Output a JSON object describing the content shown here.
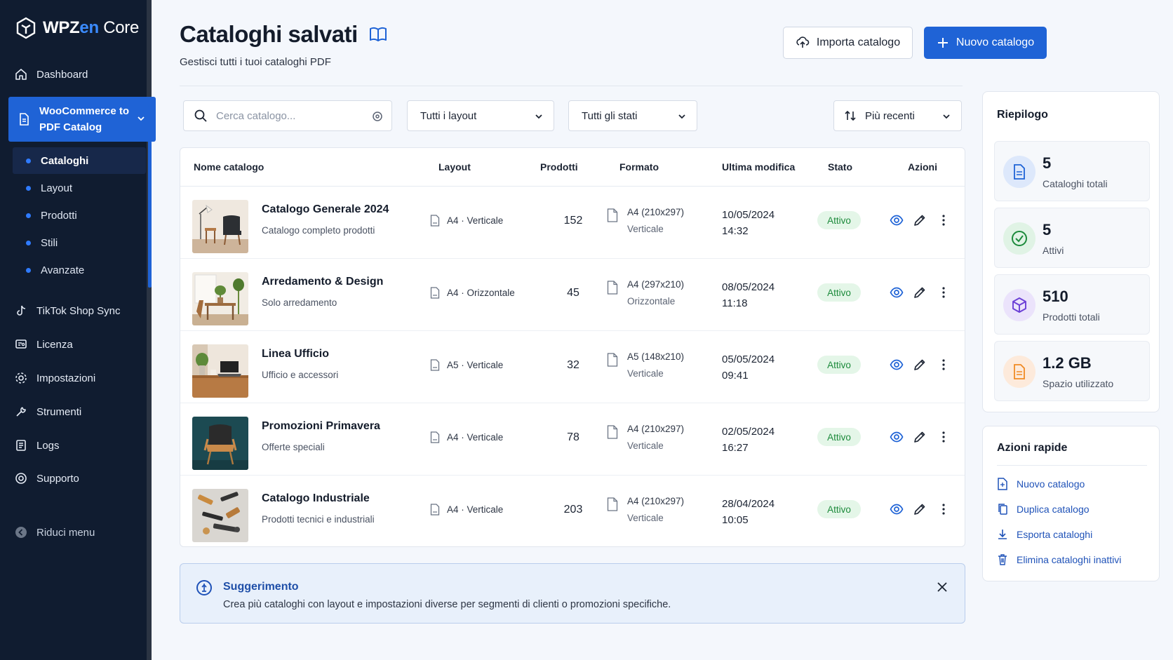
{
  "brand": {
    "part1": "WPZ",
    "part2": "en",
    "part3": " Core"
  },
  "sidebar": {
    "dashboard": "Dashboard",
    "active_section": "WooCommerce to PDF Catalog",
    "sub_items": [
      "Cataloghi",
      "Layout",
      "Prodotti",
      "Stili",
      "Avanzate"
    ],
    "items": [
      "TikTok Shop Sync",
      "Licenza",
      "Impostazioni",
      "Strumenti",
      "Logs",
      "Supporto"
    ],
    "collapse": "Riduci menu"
  },
  "header": {
    "title": "Cataloghi salvati",
    "subtitle": "Gestisci tutti i tuoi cataloghi PDF",
    "import_label": "Importa catalogo",
    "new_label": "Nuovo catalogo"
  },
  "filters": {
    "search_placeholder": "Cerca catalogo...",
    "layout": "Tutti i layout",
    "status": "Tutti gli stati",
    "sort": "Più recenti"
  },
  "table": {
    "columns": [
      "Nome catalogo",
      "Layout",
      "Prodotti",
      "Formato",
      "Ultima modifica",
      "Stato",
      "Azioni"
    ],
    "rows": [
      {
        "name": "Catalogo Generale 2024",
        "desc": "Catalogo completo prodotti",
        "layout": "A4 · Verticale",
        "products": "152",
        "format_size": "A4 (210x297)",
        "format_orient": "Verticale",
        "date": "10/05/2024",
        "time": "14:32",
        "status": "Attivo"
      },
      {
        "name": "Arredamento & Design",
        "desc": "Solo arredamento",
        "layout": "A4 · Orizzontale",
        "products": "45",
        "format_size": "A4 (297x210)",
        "format_orient": "Orizzontale",
        "date": "08/05/2024",
        "time": "11:18",
        "status": "Attivo"
      },
      {
        "name": "Linea Ufficio",
        "desc": "Ufficio e accessori",
        "layout": "A5 · Verticale",
        "products": "32",
        "format_size": "A5 (148x210)",
        "format_orient": "Verticale",
        "date": "05/05/2024",
        "time": "09:41",
        "status": "Attivo"
      },
      {
        "name": "Promozioni Primavera",
        "desc": "Offerte speciali",
        "layout": "A4 · Verticale",
        "products": "78",
        "format_size": "A4 (210x297)",
        "format_orient": "Verticale",
        "date": "02/05/2024",
        "time": "16:27",
        "status": "Attivo"
      },
      {
        "name": "Catalogo Industriale",
        "desc": "Prodotti tecnici e industriali",
        "layout": "A4 · Verticale",
        "products": "203",
        "format_size": "A4 (210x297)",
        "format_orient": "Verticale",
        "date": "28/04/2024",
        "time": "10:05",
        "status": "Attivo"
      }
    ]
  },
  "tip": {
    "title": "Suggerimento",
    "text": "Crea più cataloghi con layout e impostazioni diverse per segmenti di clienti o promozioni specifiche."
  },
  "summary": {
    "title": "Riepilogo",
    "stats": [
      {
        "value": "5",
        "label": "Cataloghi totali",
        "icon": "document-icon",
        "color": "#1f63d6"
      },
      {
        "value": "5",
        "label": "Attivi",
        "icon": "check-circle-icon",
        "color": "#1c8a3b"
      },
      {
        "value": "510",
        "label": "Prodotti totali",
        "icon": "cube-icon",
        "color": "#6b3fd6"
      },
      {
        "value": "1.2 GB",
        "label": "Spazio utilizzato",
        "icon": "file-icon",
        "color": "#f08a24"
      }
    ]
  },
  "quick_actions": {
    "title": "Azioni rapide",
    "items": [
      "Nuovo catalogo",
      "Duplica catalogo",
      "Esporta cataloghi",
      "Elimina cataloghi inattivi"
    ]
  },
  "colors": {
    "accent": "#1f63d6",
    "sidebar": "#101c30",
    "success": "#1c8a3b"
  }
}
